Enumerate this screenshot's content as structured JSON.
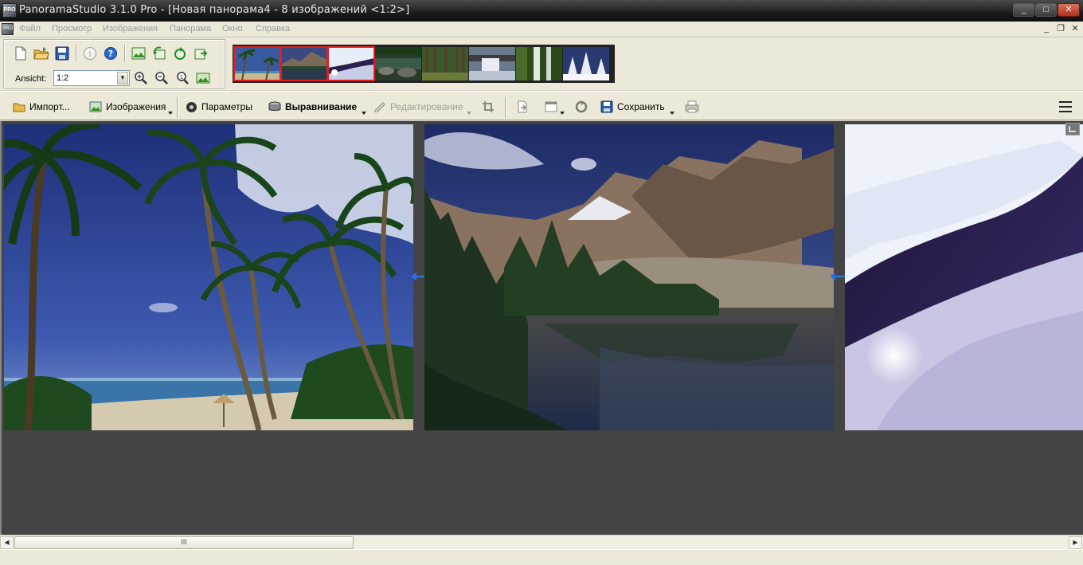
{
  "window": {
    "title": "PanoramaStudio 3.1.0 Pro - [Новая панорама4 - 8 изображений <1:2>]",
    "app_icon_text": "PRO",
    "controls": {
      "minimize": "_",
      "maximize": "□",
      "close": "✕"
    }
  },
  "menu": {
    "items": [
      "Файл",
      "Просмотр",
      "Изображения",
      "Панорама",
      "Окно",
      "Справка"
    ],
    "mdi_controls": {
      "minimize": "_",
      "restore": "❐",
      "close": "✕"
    }
  },
  "toolbar": {
    "icons": [
      "new-document-icon",
      "open-folder-icon",
      "save-icon",
      "info-icon",
      "help-icon",
      "panorama-icon",
      "rotate-left-icon",
      "rotate-right-icon",
      "export-icon"
    ],
    "view_label": "Ansicht:",
    "zoom_value": "1:2",
    "zoom_icons": [
      "zoom-in-icon",
      "zoom-out-icon",
      "zoom-actual-icon",
      "zoom-fit-icon"
    ]
  },
  "filmstrip": {
    "thumbnails": [
      {
        "subject": "palm beach",
        "selected": true
      },
      {
        "subject": "mountain lake",
        "selected": true
      },
      {
        "subject": "snow creek",
        "selected": true
      },
      {
        "subject": "river rocks",
        "selected": false
      },
      {
        "subject": "pine forest",
        "selected": false
      },
      {
        "subject": "waterfall",
        "selected": false
      },
      {
        "subject": "forest waterfall",
        "selected": false
      },
      {
        "subject": "snowy trees",
        "selected": false
      }
    ],
    "selection_color": "#e02020"
  },
  "actions": {
    "import": "Импорт...",
    "images": "Изображения",
    "parameters": "Параметры",
    "align": "Выравнивание",
    "edit": "Редактирование",
    "save": "Сохранить"
  },
  "canvas": {
    "background": "#444444",
    "photos": [
      "tropical-beach",
      "mountain-lake",
      "snowy-stream"
    ],
    "link_color": "#2f6fe0"
  },
  "scrollbar": {
    "thumb_grip": "III",
    "left_arrow": "◀",
    "right_arrow": "▶"
  }
}
